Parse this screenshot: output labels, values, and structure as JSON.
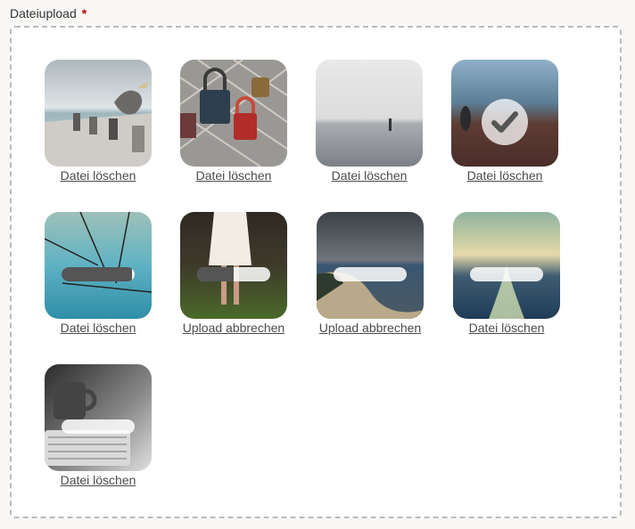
{
  "field": {
    "label": "Dateiupload",
    "required_marker": "*"
  },
  "files": [
    {
      "id": "pelican",
      "action": "Datei löschen",
      "status": "uploaded"
    },
    {
      "id": "padlocks",
      "action": "Datei löschen",
      "status": "uploaded"
    },
    {
      "id": "sea-fog",
      "action": "Datei löschen",
      "status": "uploaded"
    },
    {
      "id": "field-figure",
      "action": "Datei löschen",
      "status": "complete"
    },
    {
      "id": "power-lines",
      "action": "Datei löschen",
      "status": "uploading",
      "progress": 0.96
    },
    {
      "id": "girl-dress",
      "action": "Upload abbrechen",
      "status": "uploading",
      "progress": 0.5
    },
    {
      "id": "beach-storm",
      "action": "Upload abbrechen",
      "status": "uploading",
      "progress": 0.0
    },
    {
      "id": "ocean-sky",
      "action": "Datei löschen",
      "status": "uploading",
      "progress": 0.0
    },
    {
      "id": "coffee-keyboard",
      "action": "Datei löschen",
      "status": "uploading",
      "progress": 0.0
    }
  ],
  "colors": {
    "required": "#bb0000",
    "progress_fill": "#555555",
    "border": "#bdbbb8"
  }
}
